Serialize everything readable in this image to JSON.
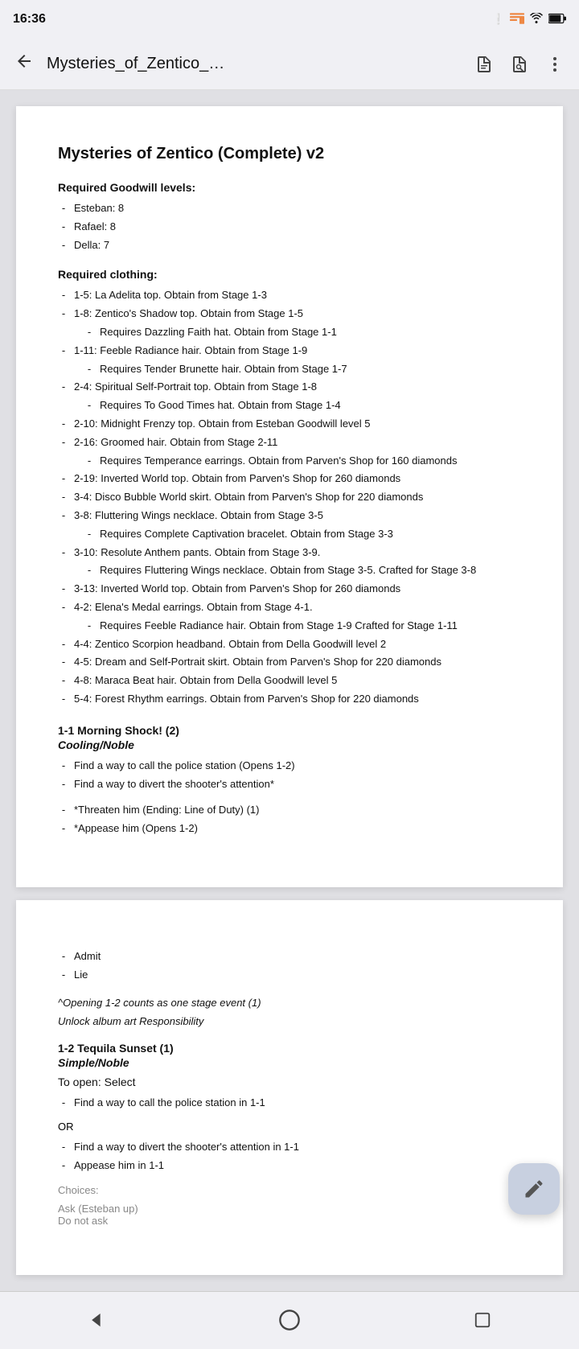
{
  "statusBar": {
    "time": "16:36",
    "icons": [
      "alert",
      "cast",
      "wifi",
      "battery"
    ]
  },
  "appBar": {
    "title": "Mysteries_of_Zentico_…",
    "backLabel": "←",
    "icons": [
      "text-format",
      "search-in-file",
      "more-options"
    ]
  },
  "document": {
    "title": "Mysteries of Zentico (Complete) v2",
    "sections": {
      "goodwill": {
        "heading": "Required Goodwill levels:",
        "items": [
          "Esteban: 8",
          "Rafael: 8",
          "Della: 7"
        ]
      },
      "clothing": {
        "heading": "Required clothing:",
        "items": [
          {
            "text": "1-5: La Adelita top. Obtain from Stage 1-3",
            "sub": null
          },
          {
            "text": "1-8: Zentico's Shadow top. Obtain from Stage 1-5",
            "sub": "Requires Dazzling Faith hat. Obtain from Stage 1-1"
          },
          {
            "text": "1-11: Feeble Radiance hair. Obtain from Stage 1-9",
            "sub": "Requires Tender Brunette hair. Obtain from Stage 1-7"
          },
          {
            "text": "2-4: Spiritual Self-Portrait top. Obtain from Stage 1-8",
            "sub": "Requires To Good Times hat. Obtain from Stage 1-4"
          },
          {
            "text": "2-10: Midnight Frenzy top. Obtain from Esteban Goodwill level 5",
            "sub": null
          },
          {
            "text": "2-16: Groomed hair. Obtain from Stage 2-11",
            "sub": "Requires Temperance earrings. Obtain from Parven's Shop for 160 diamonds"
          },
          {
            "text": "2-19: Inverted World top. Obtain from Parven's Shop for 260 diamonds",
            "sub": null
          },
          {
            "text": "3-4: Disco Bubble World skirt. Obtain from Parven's Shop for 220 diamonds",
            "sub": null
          },
          {
            "text": "3-8: Fluttering Wings necklace. Obtain from Stage 3-5",
            "sub": null
          },
          {
            "text": "3-8 sub: Requires Complete Captivation bracelet. Obtain from Stage 3-3",
            "sub": null,
            "isSub": true
          },
          {
            "text": "3-10: Resolute Anthem pants. Obtain from Stage 3-9.",
            "sub": "Requires Fluttering Wings necklace. Obtain from Stage 3-5. Crafted for Stage 3-8"
          },
          {
            "text": "3-13: Inverted World top. Obtain from Parven's Shop for 260 diamonds",
            "sub": null
          },
          {
            "text": "4-2: Elena's Medal earrings. Obtain from Stage 4-1.",
            "sub": "Requires Feeble Radiance hair. Obtain from Stage 1-9 Crafted for Stage 1-11"
          },
          {
            "text": "4-4: Zentico Scorpion headband. Obtain from Della Goodwill level 2",
            "sub": null
          },
          {
            "text": "4-5: Dream and Self-Portrait skirt. Obtain from Parven's Shop for 220 diamonds",
            "sub": null
          },
          {
            "text": "4-8: Maraca Beat hair. Obtain from Della Goodwill level 5",
            "sub": null
          },
          {
            "text": "5-4: Forest Rhythm earrings. Obtain from Parven's Shop for 220 diamonds",
            "sub": null
          }
        ]
      },
      "stage11": {
        "heading": "1-1 Morning Shock! (2)",
        "subheading": "Cooling/Noble",
        "items": [
          "Find a way to call the police station (Opens 1-2)",
          "Find a way to divert the shooter's attention*"
        ],
        "choices": [
          "*Threaten him (Ending: Line of Duty) (1)",
          "*Appease him (Opens 1-2)"
        ]
      }
    }
  },
  "page2": {
    "listItems": [
      "Admit",
      "Lie"
    ],
    "note": "^Opening 1-2 counts as one stage event (1)",
    "unlock": "Unlock album art Responsibility",
    "stage12": {
      "heading": "1-2 Tequila Sunset (1)",
      "subheading": "Simple/Noble",
      "toOpen": "To open: Select",
      "items": [
        "Find a way to call the police station in 1-1"
      ],
      "or": "OR",
      "items2": [
        "Find a way to divert the shooter's attention in 1-1",
        "Appease him in 1-1"
      ],
      "choices": "Choices:",
      "choiceItems": [
        "Ask (Esteban up)",
        "Do not ask"
      ]
    }
  },
  "fab": {
    "icon": "edit-pencil"
  },
  "bottomNav": {
    "icons": [
      "back-arrow",
      "home-circle",
      "stop-square"
    ]
  }
}
